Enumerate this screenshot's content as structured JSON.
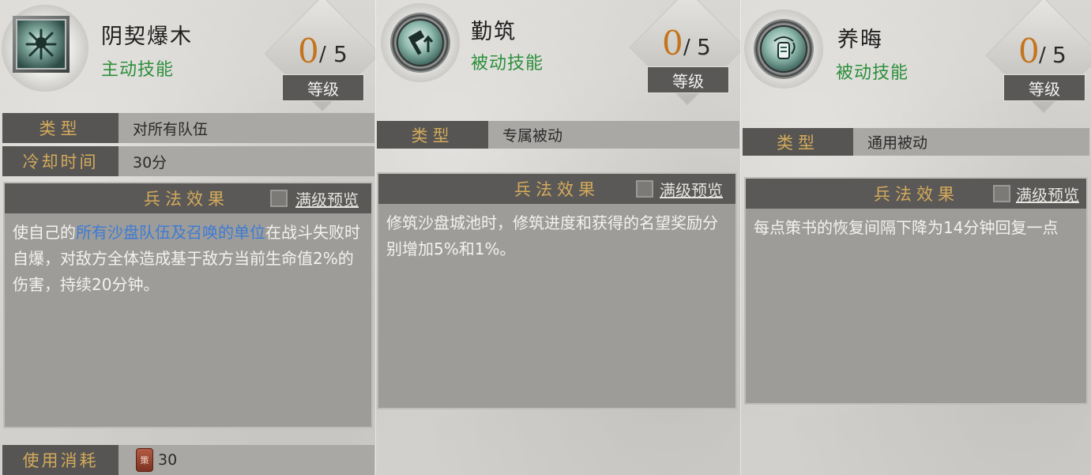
{
  "level_button_label": "等级",
  "panels": [
    {
      "name": "阴契爆木",
      "kind": "主动技能",
      "level": "0",
      "level_max": "5",
      "type_label": "类型",
      "type_value": "对所有队伍",
      "cooldown_label": "冷却时间",
      "cooldown_value": "30分",
      "effect_title": "兵法效果",
      "preview_label": "满级预览",
      "effect_parts": [
        "使自己的",
        "所有沙盘队伍及召唤的单位",
        "在战斗失败时自爆，对敌方全体造成基于敌方当前生命值2%的伤害，持续20分钟。"
      ],
      "cost_label": "使用消耗",
      "cost_icon_glyph": "策",
      "cost_value": "30",
      "icon": "exploding-figure-icon"
    },
    {
      "name": "勤筑",
      "kind": "被动技能",
      "level": "0",
      "level_max": "5",
      "type_label": "类型",
      "type_value": "专属被动",
      "effect_title": "兵法效果",
      "preview_label": "满级预览",
      "effect_text": "修筑沙盘城池时，修筑进度和获得的名望奖励分别增加5%和1%。",
      "icon": "hammer-up-arrow-icon"
    },
    {
      "name": "养晦",
      "kind": "被动技能",
      "level": "0",
      "level_max": "5",
      "type_label": "类型",
      "type_value": "通用被动",
      "effect_title": "兵法效果",
      "preview_label": "满级预览",
      "effect_text": "每点策书的恢复间隔下降为14分钟回复一点",
      "icon": "strategy-book-icon"
    }
  ],
  "colors": {
    "active_kind": "#2c8f3b",
    "level_number": "#c4741c",
    "label_gold": "#d4aa5b",
    "highlight_blue": "#3d7bd6"
  }
}
